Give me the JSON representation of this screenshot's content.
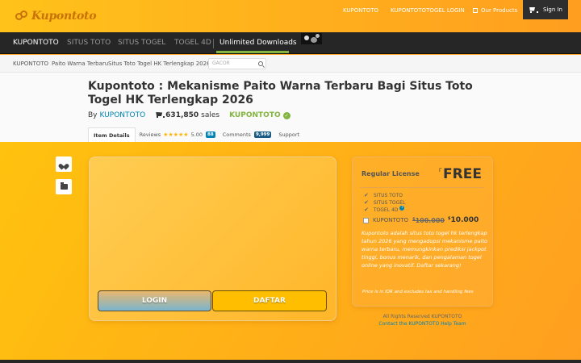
{
  "logo": {
    "text": "Kupontoto"
  },
  "top_links": {
    "kupontoto": "KUPONTOTO",
    "login": "KUPONTOTOTOGEL LOGIN",
    "our_products": "Our Products",
    "sign_in": "Sign In"
  },
  "nav": {
    "items": [
      "KUPONTOTO",
      "SITUS TOTO",
      "SITUS TOGEL",
      "TOGEL 4D",
      "Unlimited Downloads"
    ]
  },
  "breadcrumb": [
    "KUPONTOTO",
    "Paito Warna Terbaru",
    "Situs Toto Togel HK Terlengkap 2026"
  ],
  "search": {
    "placeholder": "GACOR"
  },
  "product": {
    "title": "Kupontoto : Mekanisme Paito Warna Terbaru Bagi Situs Toto Togel HK Terlengkap 2026",
    "by": "By",
    "author_link": "KUPONTOTO",
    "sales_count": "631,850",
    "sales_label": "sales",
    "author_badge": "KUPONTOTO",
    "check": "✓"
  },
  "tabs": {
    "item_details": "Item Details",
    "reviews": "Reviews",
    "rating": "5.00",
    "reviews_count": "88",
    "comments": "Comments",
    "comments_count": "9,999",
    "support": "Support",
    "stars": "★★★★★"
  },
  "buttons": {
    "login": "LOGIN",
    "daftar": "DAFTAR"
  },
  "license": {
    "label": "Regular License",
    "currency": "Г",
    "price": "FREE",
    "features": [
      "SITUS TOTO",
      "SITUS TOGEL",
      "TOGEL 4D"
    ],
    "option_label": "KUPONTOTO",
    "old_currency": "$",
    "old_price": "100.000",
    "new_currency": "$",
    "new_price": "10.000",
    "description": "Kupontoto adalah situs toto togel hk terlengkap tahun 2026 yang mengadopsi mekanisme paito warna terbaru, memungkinkan prediksi jackpot tinggi, bonus menarik, dan pengalaman togel online yang inovatif. Daftar sekarang!",
    "note": "Price is in IDR and excludes tax and handling fees"
  },
  "footer": {
    "rights": "All Rights Reserved KUPONTOTO",
    "contact": "Contact the KUPONTOTO Help Team"
  },
  "icons": [
    "logo-icon",
    "cart-icon",
    "search-icon",
    "check-icon",
    "heart-icon",
    "folder-icon",
    "info-icon"
  ],
  "colors": {
    "accent_green": "#82b440",
    "link_blue": "#0084b4",
    "nav_bg": "#262626",
    "orange_bg": "#ffa320"
  }
}
